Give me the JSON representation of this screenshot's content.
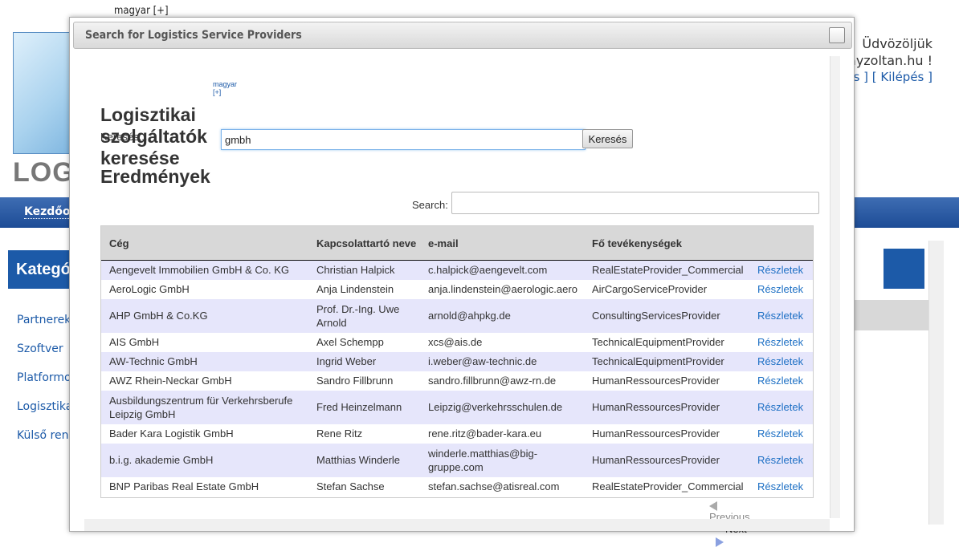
{
  "background": {
    "lang": "magyar [+]",
    "logo_text": "LOG",
    "nav_item": "Kezdőolda",
    "category_heading": "Kategóri",
    "side_items": [
      "Partnerek k",
      "Szoftver",
      "Platformok",
      "Logisztikai",
      "Külső rends"
    ],
    "welcome": "Üdvözöljük",
    "email": "s@bayzoltan.hu !",
    "links_a": "tatás",
    "links_b": "Kilépés"
  },
  "modal": {
    "title": "Search for Logistics Service Providers",
    "lang": "magyar [+]",
    "heading": "Logisztikai szolgáltatók keresése",
    "search_label": "Keresés...",
    "search_value": "gmbh",
    "search_button": "Keresés",
    "results_heading": "Eredmények",
    "filter_label": "Search:",
    "filter_value": "",
    "columns": [
      "Cég",
      "Kapcsolattartó neve",
      "e-mail",
      "Fő tevékenységek",
      ""
    ],
    "rows": [
      {
        "company": "Aengevelt Immobilien GmbH & Co. KG",
        "contact": "Christian Halpick",
        "email": "c.halpick@aengevelt.com",
        "activity": "RealEstateProvider_Commercial",
        "link": "Részletek"
      },
      {
        "company": "AeroLogic GmbH",
        "contact": "Anja Lindenstein",
        "email": "anja.lindenstein@aerologic.aero",
        "activity": "AirCargoServiceProvider",
        "link": "Részletek"
      },
      {
        "company": "AHP GmbH & Co.KG",
        "contact": "Prof. Dr.-Ing. Uwe Arnold",
        "email": "arnold@ahpkg.de",
        "activity": "ConsultingServicesProvider",
        "link": "Részletek"
      },
      {
        "company": "AIS GmbH",
        "contact": "Axel Schempp",
        "email": "xcs@ais.de",
        "activity": "TechnicalEquipmentProvider",
        "link": "Részletek"
      },
      {
        "company": "AW-Technic GmbH",
        "contact": "Ingrid Weber",
        "email": "i.weber@aw-technic.de",
        "activity": "TechnicalEquipmentProvider",
        "link": "Részletek"
      },
      {
        "company": "AWZ Rhein-Neckar GmbH",
        "contact": "Sandro Fillbrunn",
        "email": "sandro.fillbrunn@awz-rn.de",
        "activity": "HumanRessourcesProvider",
        "link": "Részletek"
      },
      {
        "company": "Ausbildungszentrum für Verkehrsberufe Leipzig GmbH",
        "contact": "Fred Heinzelmann",
        "email": "Leipzig@verkehrsschulen.de",
        "activity": "HumanRessourcesProvider",
        "link": "Részletek"
      },
      {
        "company": "Bader Kara Logistik GmbH",
        "contact": "Rene Ritz",
        "email": "rene.ritz@bader-kara.eu",
        "activity": "HumanRessourcesProvider",
        "link": "Részletek"
      },
      {
        "company": "b.i.g. akademie GmbH",
        "contact": "Matthias Winderle",
        "email": "winderle.matthias@big-gruppe.com",
        "activity": "HumanRessourcesProvider",
        "link": "Részletek"
      },
      {
        "company": "BNP Paribas Real Estate GmbH",
        "contact": "Stefan Sachse",
        "email": "stefan.sachse@atisreal.com",
        "activity": "RealEstateProvider_Commercial",
        "link": "Részletek"
      }
    ],
    "pager": {
      "previous": "Previous",
      "next": "Next"
    }
  }
}
